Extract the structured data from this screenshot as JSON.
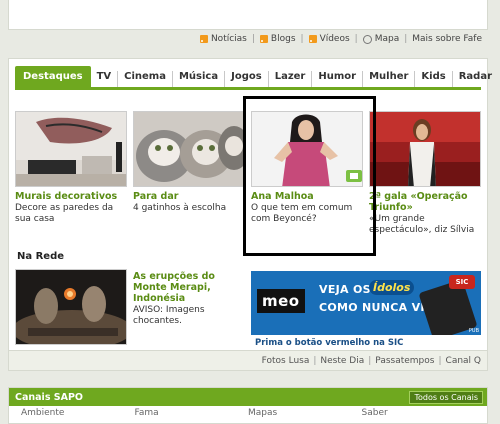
{
  "top_links": [
    {
      "label": "Notícias",
      "icon": "rss-icon"
    },
    {
      "label": "Blogs",
      "icon": "rss-icon"
    },
    {
      "label": "Vídeos",
      "icon": "rss-icon"
    },
    {
      "label": "Mapa",
      "icon": "globe-icon"
    },
    {
      "label": "Mais sobre Fafe",
      "icon": ""
    }
  ],
  "tabs": [
    "Destaques",
    "TV",
    "Cinema",
    "Música",
    "Jogos",
    "Lazer",
    "Humor",
    "Mulher",
    "Kids",
    "Radar"
  ],
  "cards": [
    {
      "title": "Murais decorativos",
      "desc": "Decore as paredes da sua casa"
    },
    {
      "title": "Para dar",
      "desc": "4 gatinhos à escolha"
    },
    {
      "title": "Ana Malhoa",
      "desc": "O que tem em comum com Beyoncé?"
    },
    {
      "title": "2ª gala «Operação Triunfo»",
      "desc": "«Um grande espectáculo», diz Sílvia"
    }
  ],
  "section_title": "Na Rede",
  "wide_item": {
    "title": "As erupções do Monte Merapi, Indonésia",
    "desc": "AVISO: Imagens chocantes."
  },
  "banner": {
    "brand": "meo",
    "line1": "VEJA OS",
    "idolos": "Ídolos",
    "line2": "COMO NUNCA VIU!",
    "bottom": "Prima o botão vermelho na SIC",
    "sic": "SIC",
    "pub": "PUB"
  },
  "footer_links": [
    "Fotos Lusa",
    "Neste Dia",
    "Passatempos",
    "Canal Q"
  ],
  "canais": {
    "title": "Canais SAPO",
    "button": "Todos os Canais",
    "columns": [
      "Ambiente",
      "Fama",
      "Mapas",
      "Saber"
    ]
  },
  "colors": {
    "accent": "#6fa81f",
    "title_green": "#5a8c14",
    "banner_blue": "#1a6fb8"
  }
}
